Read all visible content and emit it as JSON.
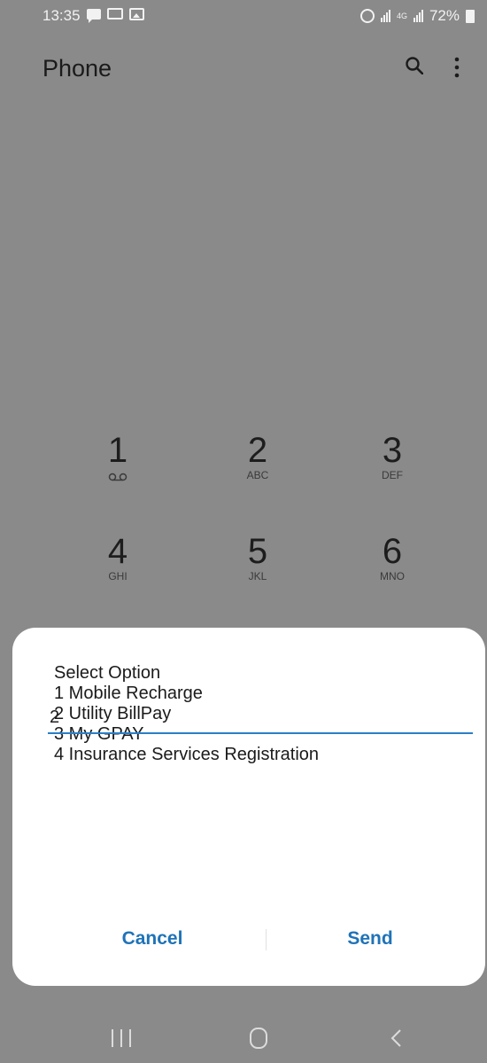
{
  "status_bar": {
    "time": "13:35",
    "battery": "72%",
    "network": "4G"
  },
  "app": {
    "title": "Phone",
    "icons": [
      "search-icon",
      "more-options-icon"
    ]
  },
  "dialpad": {
    "keys": [
      {
        "digit": "1",
        "letters": "",
        "icon": "voicemail-icon"
      },
      {
        "digit": "2",
        "letters": "ABC"
      },
      {
        "digit": "3",
        "letters": "DEF"
      },
      {
        "digit": "4",
        "letters": "GHI"
      },
      {
        "digit": "5",
        "letters": "JKL"
      },
      {
        "digit": "6",
        "letters": "MNO"
      }
    ]
  },
  "dialog": {
    "lines": [
      "Select Option",
      "1 Mobile Recharge",
      "2 Utility BillPay",
      "3 My GPAY",
      "4 Insurance Services Registration"
    ],
    "input_value": "2",
    "cancel_label": "Cancel",
    "send_label": "Send",
    "accent_color": "#1e73b8"
  },
  "nav_bar": {
    "icons": [
      "recents-icon",
      "home-icon",
      "back-icon"
    ]
  }
}
